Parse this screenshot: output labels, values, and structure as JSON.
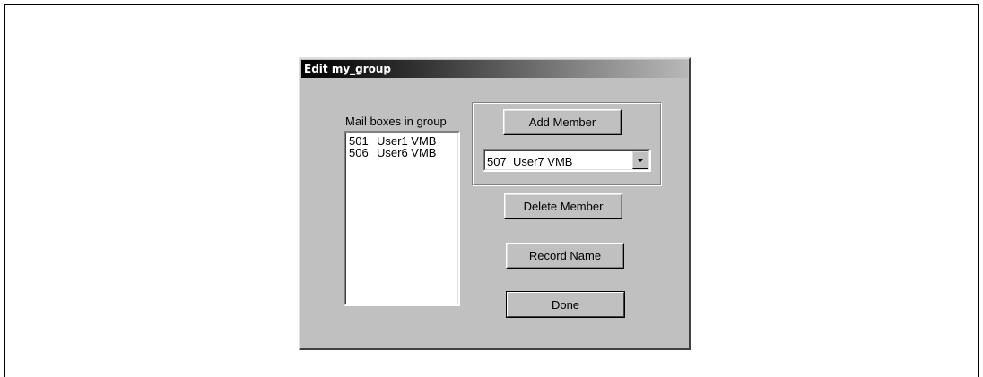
{
  "dialog": {
    "title": "Edit my_group"
  },
  "mailboxes": {
    "label": "Mail boxes in group",
    "items": [
      {
        "number": "501",
        "name": "User1 VMB"
      },
      {
        "number": "506",
        "name": "User6 VMB"
      }
    ]
  },
  "add_member": {
    "button_label": "Add Member",
    "selected": {
      "number": "507",
      "name": "User7 VMB"
    }
  },
  "buttons": {
    "delete_member": "Delete Member",
    "record_name": "Record Name",
    "done": "Done"
  },
  "icons": {
    "dropdown": "chevron-down-icon"
  },
  "colors": {
    "dialog_face": "#c0c0c0",
    "title_gradient_start": "#000000",
    "title_gradient_end": "#b8b8b8"
  }
}
